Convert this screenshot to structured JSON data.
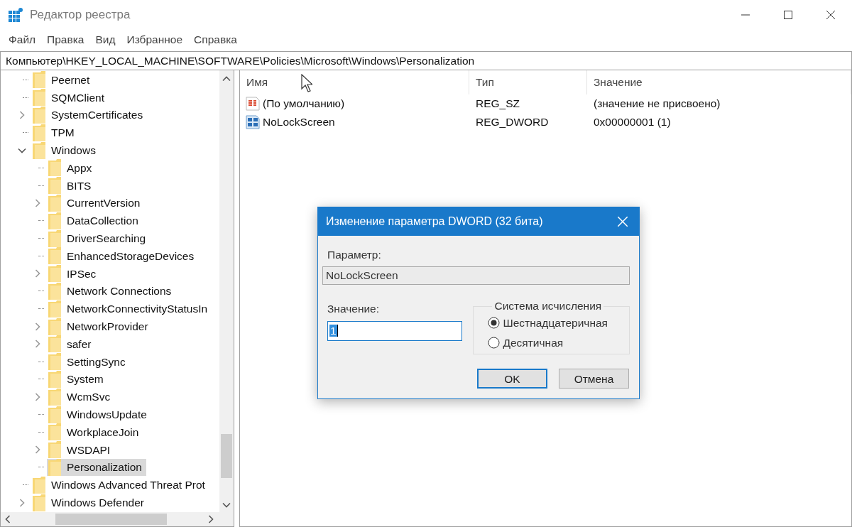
{
  "window": {
    "title": "Редактор реестра"
  },
  "menu": [
    "Файл",
    "Правка",
    "Вид",
    "Избранное",
    "Справка"
  ],
  "address_bar": {
    "value": "Компьютер\\HKEY_LOCAL_MACHINE\\SOFTWARE\\Policies\\Microsoft\\Windows\\Personalization"
  },
  "tree": {
    "items": [
      {
        "label": "Peernet",
        "expandable": false,
        "selected": false
      },
      {
        "label": "SQMClient",
        "expandable": false,
        "selected": false
      },
      {
        "label": "SystemCertificates",
        "expandable": true,
        "expanded": false,
        "selected": false
      },
      {
        "label": "TPM",
        "expandable": false,
        "selected": false
      },
      {
        "label": "Windows",
        "expandable": true,
        "expanded": true,
        "selected": false,
        "children": [
          {
            "label": "Appx",
            "expandable": false,
            "selected": false
          },
          {
            "label": "BITS",
            "expandable": false,
            "selected": false
          },
          {
            "label": "CurrentVersion",
            "expandable": true,
            "expanded": false,
            "selected": false
          },
          {
            "label": "DataCollection",
            "expandable": false,
            "selected": false
          },
          {
            "label": "DriverSearching",
            "expandable": false,
            "selected": false
          },
          {
            "label": "EnhancedStorageDevices",
            "expandable": false,
            "selected": false
          },
          {
            "label": "IPSec",
            "expandable": true,
            "expanded": false,
            "selected": false
          },
          {
            "label": "Network Connections",
            "expandable": false,
            "selected": false
          },
          {
            "label": "NetworkConnectivityStatusIn",
            "expandable": false,
            "selected": false
          },
          {
            "label": "NetworkProvider",
            "expandable": true,
            "expanded": false,
            "selected": false
          },
          {
            "label": "safer",
            "expandable": true,
            "expanded": false,
            "selected": false
          },
          {
            "label": "SettingSync",
            "expandable": false,
            "selected": false
          },
          {
            "label": "System",
            "expandable": false,
            "selected": false
          },
          {
            "label": "WcmSvc",
            "expandable": true,
            "expanded": false,
            "selected": false
          },
          {
            "label": "WindowsUpdate",
            "expandable": false,
            "selected": false
          },
          {
            "label": "WorkplaceJoin",
            "expandable": false,
            "selected": false
          },
          {
            "label": "WSDAPI",
            "expandable": true,
            "expanded": false,
            "selected": false
          },
          {
            "label": "Personalization",
            "expandable": false,
            "selected": true
          }
        ]
      },
      {
        "label": "Windows Advanced Threat Prot",
        "expandable": false,
        "selected": false
      },
      {
        "label": "Windows Defender",
        "expandable": true,
        "expanded": false,
        "selected": false
      }
    ]
  },
  "values_table": {
    "columns": [
      "Имя",
      "Тип",
      "Значение"
    ],
    "rows": [
      {
        "kind": "string",
        "name": "(По умолчанию)",
        "type": "REG_SZ",
        "data": "(значение не присвоено)"
      },
      {
        "kind": "dword",
        "name": "NoLockScreen",
        "type": "REG_DWORD",
        "data": "0x00000001 (1)"
      }
    ]
  },
  "dialog": {
    "title": "Изменение параметра DWORD (32 бита)",
    "parameter_label": "Параметр:",
    "parameter_value": "NoLockScreen",
    "value_label": "Значение:",
    "value": "1",
    "value_text_selected": true,
    "base_group": {
      "title": "Система исчисления",
      "options": [
        {
          "label": "Шестнадцатеричная",
          "selected": true
        },
        {
          "label": "Десятичная",
          "selected": false
        }
      ]
    },
    "buttons": [
      {
        "label": "OK",
        "default": true
      },
      {
        "label": "Отмена",
        "default": false
      }
    ]
  }
}
